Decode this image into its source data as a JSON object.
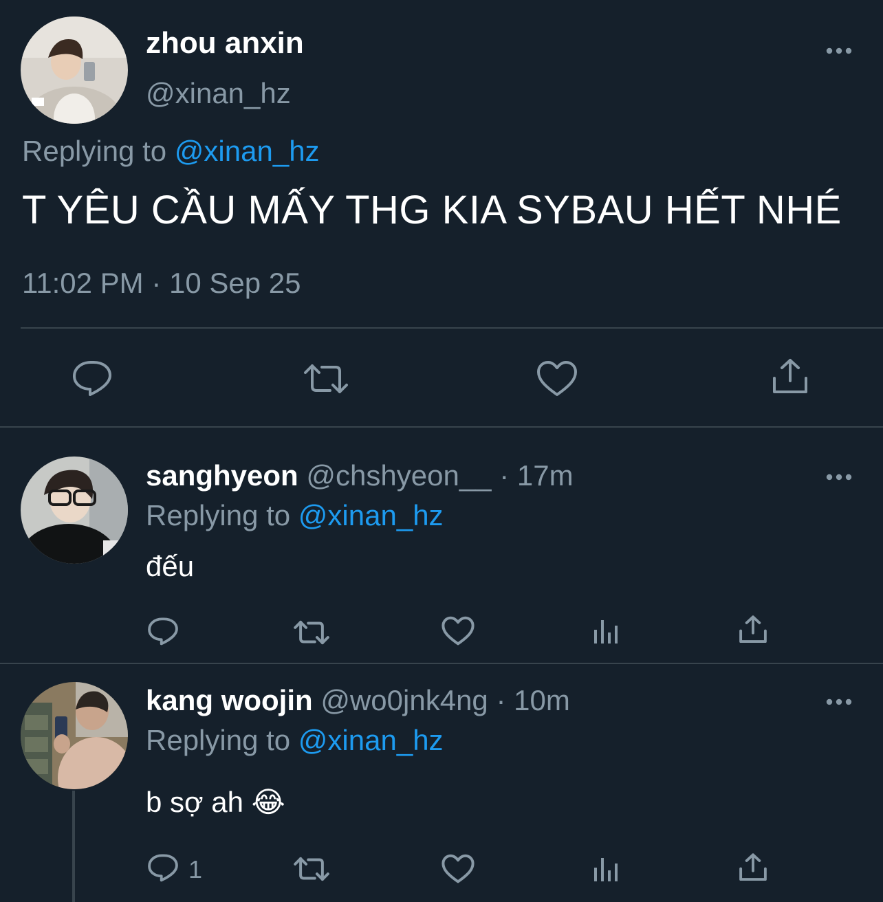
{
  "main_tweet": {
    "name": "zhou anxin",
    "handle": "@xinan_hz",
    "replying_prefix": "Replying to",
    "replying_handle": "@xinan_hz",
    "text": "T YÊU CẦU MẤY THG KIA SYBAU HẾT NHÉ",
    "timestamp": "11:02 PM · 10 Sep 25",
    "actions": [
      "reply-icon",
      "retweet-icon",
      "like-icon",
      "share-icon"
    ]
  },
  "replies": [
    {
      "name": "sanghyeon",
      "handle": "@chshyeon__",
      "time": "· 17m",
      "replying_prefix": "Replying to",
      "replying_handle": "@xinan_hz",
      "text": "đếu",
      "reply_count": ""
    },
    {
      "name": "kang woojin",
      "handle": "@wo0jnk4ng",
      "time": "· 10m",
      "replying_prefix": "Replying to",
      "replying_handle": "@xinan_hz",
      "text": "b sợ ah 😂",
      "reply_count": "1"
    }
  ],
  "colors": {
    "background": "#15202b",
    "secondary_text": "#8899a6",
    "accent": "#1d9bf0",
    "divider": "#38444d"
  }
}
